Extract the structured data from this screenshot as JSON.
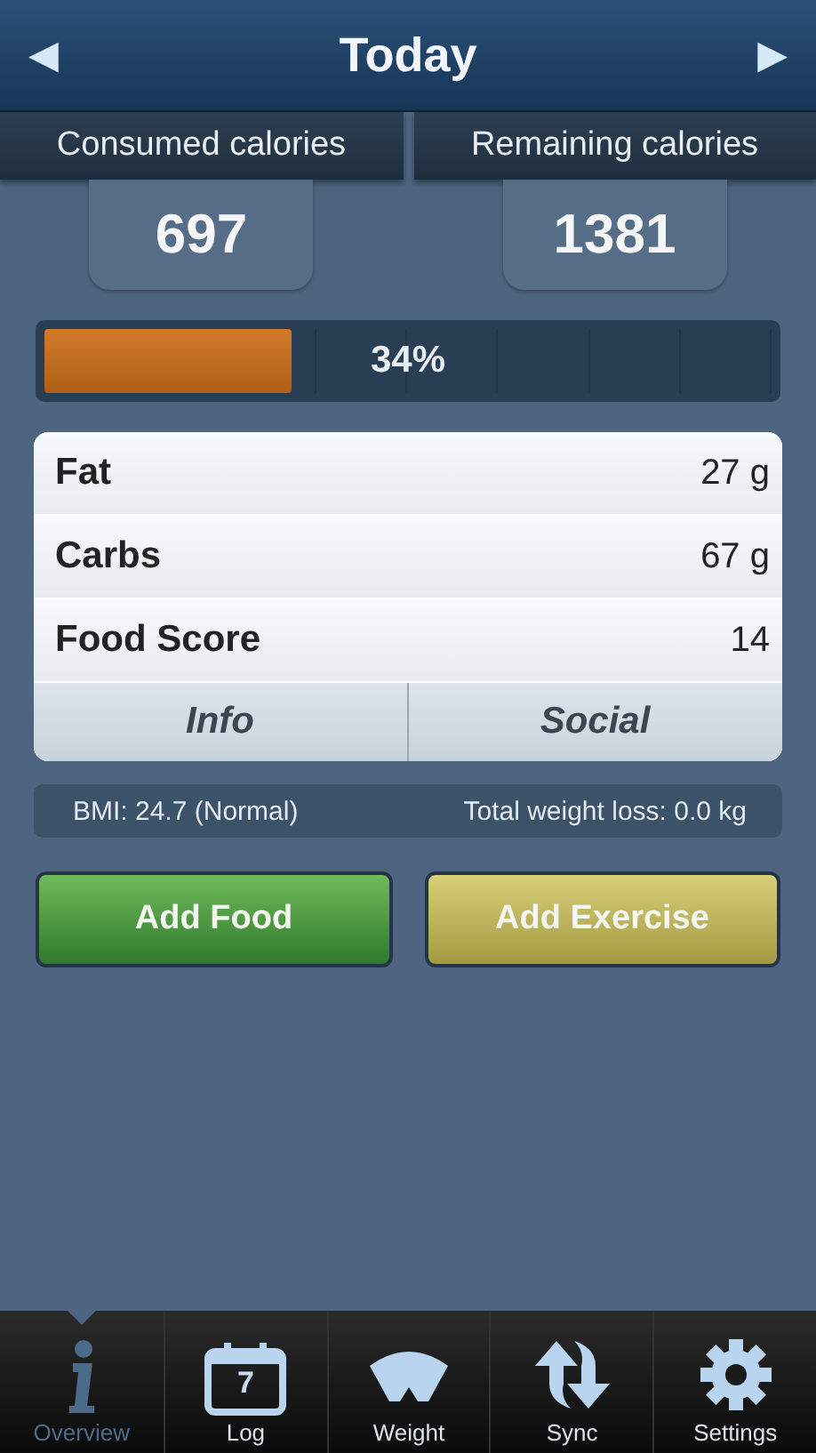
{
  "header": {
    "title": "Today",
    "prev": "◀",
    "next": "▶"
  },
  "calories": [
    {
      "label": "Consumed calories",
      "value": "697"
    },
    {
      "label": "Remaining calories",
      "value": "1381"
    }
  ],
  "progress": {
    "level": 0.34,
    "reading": "34%"
  },
  "nutrients": [
    {
      "label": "Fat",
      "value": "27 g"
    },
    {
      "label": "Carbs",
      "value": "67 g"
    },
    {
      "label": "Food Score",
      "value": "14"
    }
  ],
  "card_buttons": [
    "Info",
    "Social"
  ],
  "stats": {
    "bmi": "BMI: 24.7 (Normal)",
    "weight_loss": "Total weight loss: 0.0 kg"
  },
  "actions": [
    {
      "label": "Add Food",
      "kind": "food"
    },
    {
      "label": "Add Exercise",
      "kind": "exercise"
    }
  ],
  "tabs": [
    {
      "label": "Overview",
      "kind": "info",
      "selected": true
    },
    {
      "label": "Log",
      "kind": "calendar",
      "icon_text": "7",
      "selected": false
    },
    {
      "label": "Weight",
      "kind": "scale",
      "selected": false
    },
    {
      "label": "Sync",
      "kind": "sync",
      "selected": false
    },
    {
      "label": "Settings",
      "kind": "gear",
      "selected": false
    }
  ]
}
